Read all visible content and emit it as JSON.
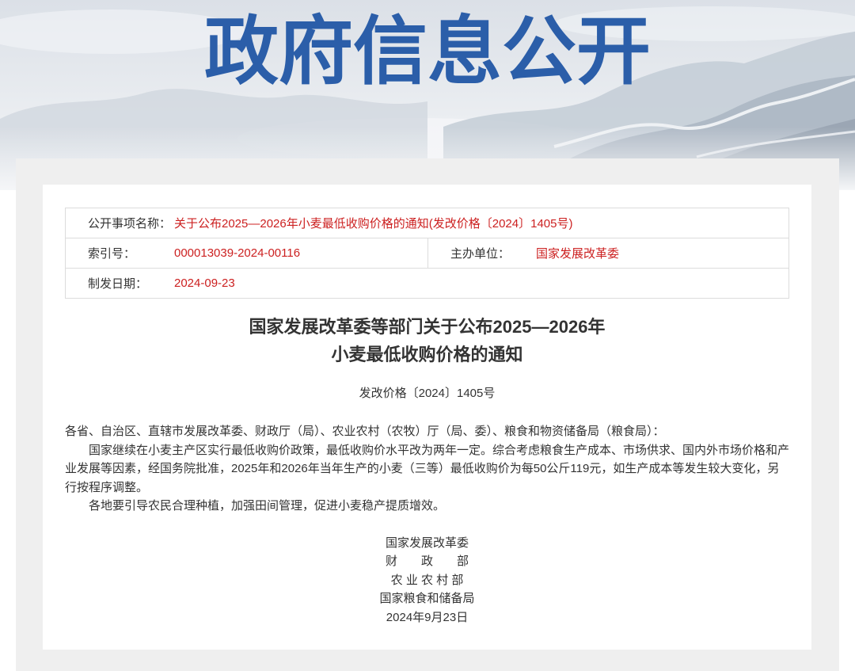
{
  "banner": {
    "title": "政府信息公开"
  },
  "meta": {
    "item_name_label": "公开事项名称：",
    "item_name_value": "关于公布2025—2026年小麦最低收购价格的通知(发改价格〔2024〕1405号)",
    "index_label": "索引号：",
    "index_value": "000013039-2024-00116",
    "organizer_label": "主办单位：",
    "organizer_value": "国家发展改革委",
    "date_label": "制发日期：",
    "date_value": "2024-09-23"
  },
  "document": {
    "title_lines": [
      "国家发展改革委等部门关于公布2025—2026年",
      "小麦最低收购价格的通知"
    ],
    "doc_number": "发改价格〔2024〕1405号",
    "salutation": "各省、自治区、直辖市发展改革委、财政厅（局）、农业农村（农牧）厅（局、委）、粮食和物资储备局（粮食局）：",
    "paragraphs": [
      "国家继续在小麦主产区实行最低收购价政策，最低收购价水平改为两年一定。综合考虑粮食生产成本、市场供求、国内外市场价格和产业发展等因素，经国务院批准，2025年和2026年当年生产的小麦（三等）最低收购价为每50公斤119元，如生产成本等发生较大变化，另行按程序调整。",
      "各地要引导农民合理种植，加强田间管理，促进小麦稳产提质增效。"
    ],
    "signatures": [
      "国家发展改革委",
      "财　　政　　部",
      "农 业 农 村 部",
      "国家粮食和储备局"
    ],
    "date": "2024年9月23日"
  },
  "colors": {
    "banner_title": "#2b5ea9",
    "meta_value": "#cc2020",
    "panel_background": "#efefef",
    "text": "#333333"
  }
}
